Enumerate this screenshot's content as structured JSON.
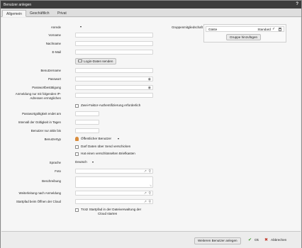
{
  "window": {
    "title": "Benutzer anlegen",
    "help": "?"
  },
  "tabs": [
    {
      "label": "Allgemein"
    },
    {
      "label": "Geschäftlich"
    },
    {
      "label": "Privat"
    }
  ],
  "form": {
    "salutation_label": "Anrede",
    "firstname_label": "Vorname",
    "lastname_label": "Nachname",
    "email_label": "E-Mail",
    "send_login_button": "Login-Daten senden",
    "username_label": "Benutzername",
    "password_label": "Passwort",
    "password_confirm_label": "Passwortbestätigung",
    "ip_label_1": "Anmeldung nur mit folgenden IP-",
    "ip_label_2": "Adressen ermöglichen",
    "twofactor_label": "Zwei-Faktor-Authentifizierung erforderlich",
    "pw_expiry_label": "Passwortgültigkeit endet am",
    "validity_interval_label": "Intervall der Gültigkeit in Tagen",
    "active_until_label": "Benutzer nur aktiv bis",
    "usertype_label": "Benutzertyp",
    "usertype_value": "Öffentlicher Benutzer",
    "send_data_label": "Darf Daten über Send verschicken",
    "encrypted_mailbox_label": "Hat einen verschlüsselten Briefkasten",
    "language_label": "Sprache",
    "language_value": "Deutsch",
    "photo_label": "Foto",
    "description_label": "Beschreibung",
    "redirect_label": "Weiterleitung nach Anmeldung",
    "startpath_label": "Startpfad beim Öffnen der Cloud",
    "startpath_check_1": "Trotz Startpfad in der Dateiverwaltung der",
    "startpath_check_2": "Cloud starten"
  },
  "groups": {
    "label": "Gruppenmitgliedschaft",
    "items": [
      {
        "name": "Gäste",
        "standard_label": "Standard",
        "standard_checked": true
      }
    ],
    "add_button": "Gruppe hinzufügen"
  },
  "footer": {
    "more_button": "Weiteren Benutzer anlegen",
    "ok_button": "Ok",
    "cancel_button": "Abbrechen"
  },
  "colors": {
    "ok_green": "#3f9a2f",
    "cancel_red": "#c0392b",
    "titlebar": "#3d3d3d"
  }
}
